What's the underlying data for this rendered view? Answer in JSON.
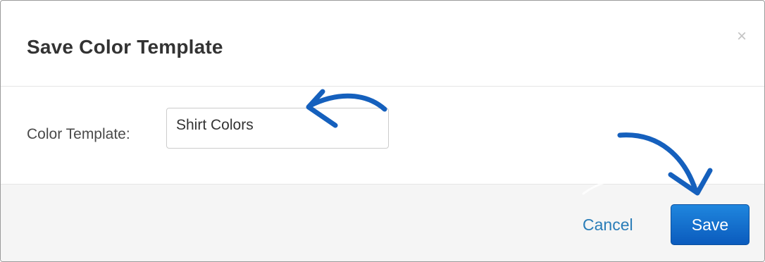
{
  "dialog": {
    "title": "Save Color Template",
    "close_symbol": "×",
    "close_icon": "close-icon"
  },
  "form": {
    "label": "Color Template:",
    "value": "Shirt Colors"
  },
  "footer": {
    "cancel_label": "Cancel",
    "save_label": "Save"
  },
  "annotations": {
    "arrow_color": "#1560bd",
    "arrows": [
      "arrow-to-input-icon",
      "arrow-to-save-icon"
    ]
  },
  "colors": {
    "primary": "#0b5bbd",
    "link": "#2a7db8",
    "footer_bg": "#f5f5f5"
  }
}
